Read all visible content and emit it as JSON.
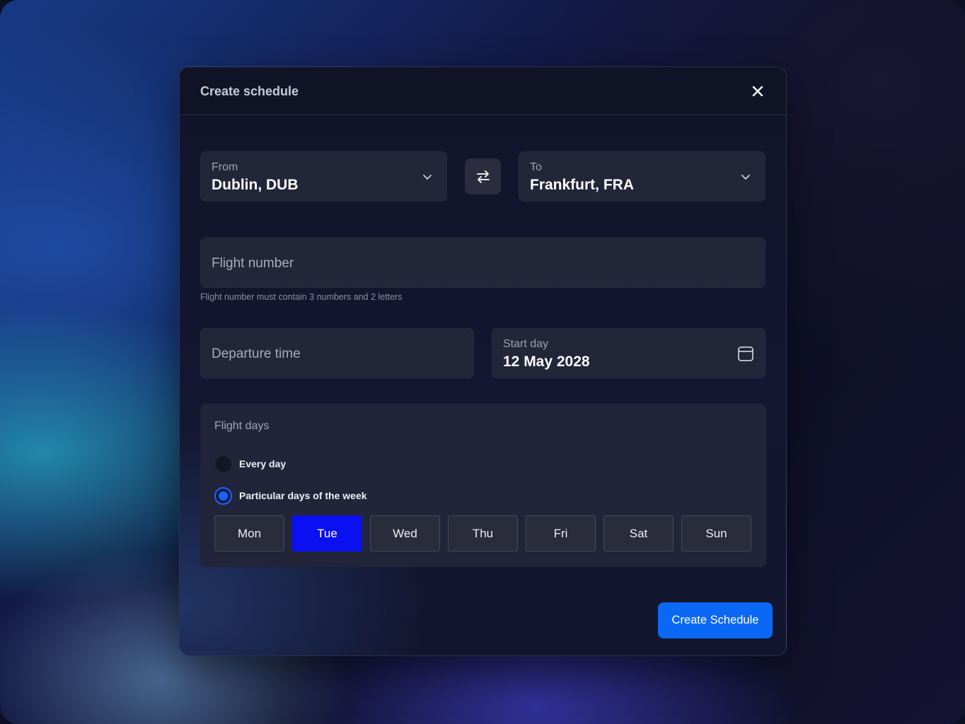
{
  "modal": {
    "title": "Create schedule"
  },
  "route": {
    "from": {
      "label": "From",
      "value": "Dublin, DUB"
    },
    "to": {
      "label": "To",
      "value": "Frankfurt, FRA"
    }
  },
  "flight_number": {
    "placeholder": "Flight number",
    "hint": "Flight number must contain 3 numbers and 2 letters"
  },
  "departure_time": {
    "placeholder": "Departure time"
  },
  "start_day": {
    "label": "Start day",
    "value": "12 May 2028"
  },
  "flight_days": {
    "label": "Flight days",
    "options": [
      {
        "label": "Every day",
        "selected": false
      },
      {
        "label": "Particular days of the week",
        "selected": true
      }
    ],
    "days": [
      {
        "label": "Mon",
        "selected": false
      },
      {
        "label": "Tue",
        "selected": true
      },
      {
        "label": "Wed",
        "selected": false
      },
      {
        "label": "Thu",
        "selected": false
      },
      {
        "label": "Fri",
        "selected": false
      },
      {
        "label": "Sat",
        "selected": false
      },
      {
        "label": "Sun",
        "selected": false
      }
    ]
  },
  "actions": {
    "submit_label": "Create Schedule"
  },
  "colors": {
    "accent": "#0b68f5",
    "day_selected": "#0a10f0"
  }
}
